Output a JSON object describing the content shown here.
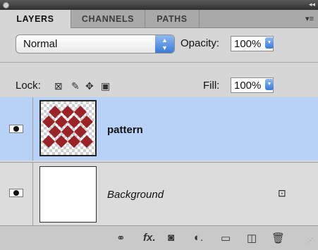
{
  "tabs": [
    "LAYERS",
    "CHANNELS",
    "PATHS"
  ],
  "panel_menu_icon": "panel-menu-icon",
  "blend_mode": {
    "value": "Normal"
  },
  "opacity": {
    "label": "Opacity:",
    "value": "100%"
  },
  "lock": {
    "label": "Lock:"
  },
  "fill": {
    "label": "Fill:",
    "value": "100%"
  },
  "layers": [
    {
      "name": "pattern",
      "selected": true,
      "visible": true
    },
    {
      "name": "Background",
      "selected": false,
      "visible": true,
      "locked": true
    }
  ],
  "colors": {
    "selection": "#b7d1f7",
    "pattern_red": "#9a2327",
    "panel": "#d6d6d6"
  },
  "bottom_icons": [
    "link-layers-icon",
    "fx-icon",
    "add-mask-icon",
    "adjustment-layer-icon",
    "new-group-icon",
    "new-layer-icon",
    "trash-icon"
  ]
}
